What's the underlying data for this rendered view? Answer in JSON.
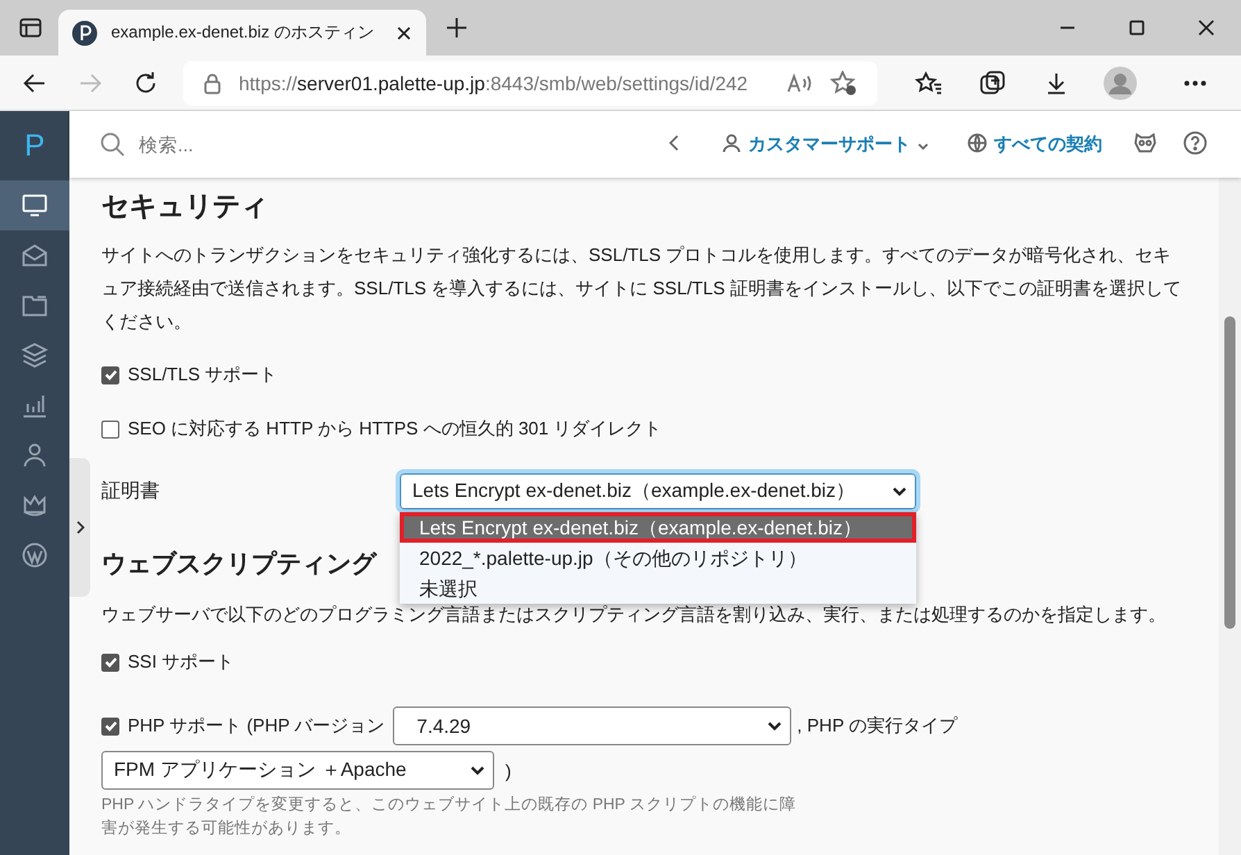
{
  "browser": {
    "tab_title": "example.ex-denet.biz のホスティン",
    "url": {
      "scheme": "https://",
      "host": "server01.palette-up.jp",
      "path": ":8443/smb/web/settings/id/242"
    },
    "forward_disabled": true
  },
  "sidebar": {
    "logo": "P",
    "items": [
      {
        "kind": "monitor",
        "selected": true
      },
      {
        "kind": "mail",
        "selected": false
      },
      {
        "kind": "folder",
        "selected": false
      },
      {
        "kind": "layers",
        "selected": false
      },
      {
        "kind": "chart",
        "selected": false
      },
      {
        "kind": "user",
        "selected": false
      },
      {
        "kind": "crown",
        "selected": false
      },
      {
        "kind": "wp",
        "selected": false
      }
    ]
  },
  "header": {
    "search": {
      "placeholder": "検索..."
    },
    "support": "カスタマーサポート",
    "subscriptions": "すべての契約"
  },
  "security": {
    "title": "セキュリティ",
    "description": "サイトへのトランザクションをセキュリティ強化するには、SSL/TLS プロトコルを使用します。すべてのデータが暗号化され、セキュア接続経由で送信されます。SSL/TLS を導入するには、サイトに SSL/TLS 証明書をインストールし、以下でこの証明書を選択してください。",
    "options": [
      {
        "label": "SSL/TLS サポート",
        "checked": true
      },
      {
        "label": "SEO に対応する HTTP から HTTPS への恒久的 301 リダイレクト",
        "checked": false
      }
    ],
    "certificate": {
      "label": "証明書",
      "value": "Lets Encrypt ex-denet.biz（example.ex-denet.biz）",
      "expanded": true,
      "options": [
        {
          "label": "Lets Encrypt ex-denet.biz（example.ex-denet.biz）",
          "selected": true
        },
        {
          "label": "2022_*.palette-up.jp（その他のリポジトリ）",
          "selected": false
        },
        {
          "label": "未選択",
          "selected": false
        }
      ]
    }
  },
  "scripting": {
    "title": "ウェブスクリプティング",
    "description": "ウェブサーバで以下のどのプログラミング言語またはスクリプティング言語を割り込み、実行、または処理するのかを指定します。",
    "ssi": {
      "label": "SSI サポート",
      "checked": true
    },
    "php": {
      "label": "PHP サポート (PHP バージョン",
      "checked": true,
      "version": "7.4.29",
      "type_label": ", PHP の実行タイプ",
      "handler": "FPM アプリケーション ＋Apache",
      "close_paren": ")",
      "note": "PHP ハンドラタイプを変更すると、このウェブサイト上の既存の PHP スクリプトの機能に障害が発生する可能性があります。"
    }
  }
}
